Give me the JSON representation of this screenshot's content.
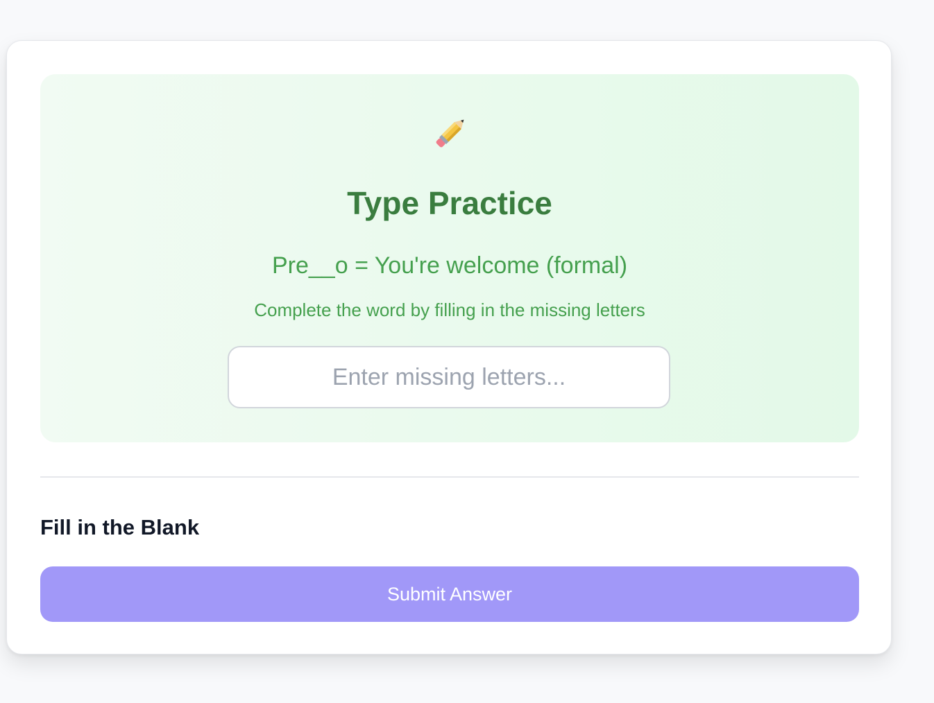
{
  "practice": {
    "icon": "pencil-icon",
    "title": "Type Practice",
    "prompt": "Pre__o = You're welcome (formal)",
    "instruction": "Complete the word by filling in the missing letters",
    "input_placeholder": "Enter missing letters...",
    "input_value": ""
  },
  "section": {
    "label": "Fill in the Blank"
  },
  "actions": {
    "submit_label": "Submit Answer"
  },
  "colors": {
    "page_background": "#f8f9fb",
    "panel_gradient_start": "#f1fbf3",
    "panel_gradient_end": "#e3f9e8",
    "title_green": "#3a7d3f",
    "text_green": "#45a04e",
    "submit_button": "#a198f8"
  }
}
